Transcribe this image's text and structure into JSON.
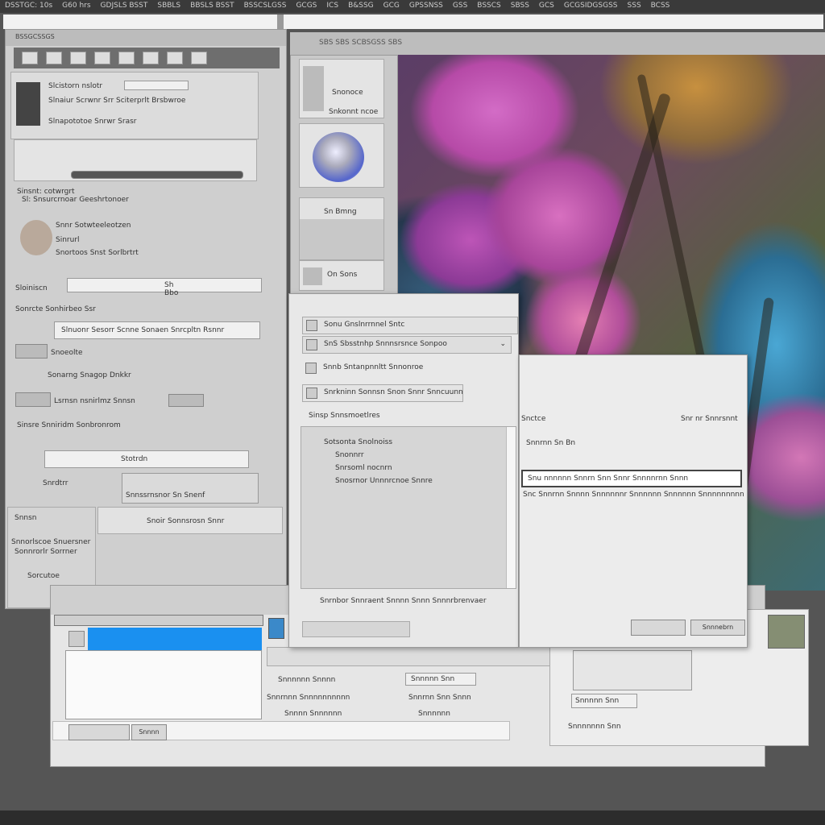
{
  "menubar": {
    "items": [
      "DSSTGC: 10s",
      "G60 hrs",
      "GDJSLS BSST",
      "SBBLS",
      "BBSLS BSST",
      "BSSCSLGSS",
      "GCGS",
      "ICS",
      "B&SSG",
      "GCG",
      "GPSSNSS",
      "GSS",
      "BSSCS",
      "SBSS",
      "GCS",
      "GCGSIDGSGSS",
      "SSS",
      "BCSS"
    ]
  },
  "left_panel": {
    "header": "BSSGCSSGS",
    "layer1_name": "Slcistorn nslotr",
    "layer1_value": "Slnaiur Scrwnr Srr Sciterprlt Brsbwroe",
    "layer2_name": "Slnapototoe Snrwr Srasr",
    "section_label": "Sinsnt: cotwrgrt",
    "section_sub": "Sl: Snsurcrnoar Geeshrtonoer",
    "profile_name": "Snnr Sotwteeleotzen",
    "profile_sub": "Sinrurl",
    "profile_sub2": "Snortoos Snst Sorlbrtrt",
    "field_label": "Sloiniscn",
    "field_value": "Sh Bbo",
    "opt_row": "Sonrcte Sonhirbeo Ssr",
    "input_value": "Slnuonr Sesorr Scnne Sonaen Snrcpltn Rsnnr",
    "item1": "Snoeolte",
    "item2": "Sonarng Snagop Dnkkr",
    "item3": "Lsrnsn nsnirlmz Snnsn",
    "section2": "Sinsre Snniridm Sonbronrom",
    "btn_center": "Stotrdn",
    "foot1": "Snrdtrr",
    "foot2": "Snnssrnsnor Sn Snenf",
    "foot3": "Snoir Sonnsrosn Snnr",
    "sub_a": "Snnsn",
    "sub_b": "Snnorlscoe Snuersner",
    "sub_c": "Sonnrorlr Sorrner",
    "sub_d": "Sorcutoe"
  },
  "thumb_panel": {
    "thumb1_label": "Snonoce",
    "thumb1_sub": "Snkonnt ncoe",
    "thumb3_label": "Sn Bmng",
    "thumb4_label": "On Sons"
  },
  "main_header": "SBS SBS SCBSGSS SBS",
  "dialog": {
    "row1": "Sonu Gnslnrrnnel Sntc",
    "row2": "SnS Sbsstnhp Snnnsrsnce Sonpoo",
    "row3": "Snnb Sntanpnnltt Snnonroe",
    "row4": "Snrkninn Sonnsn Snon Snnr Snncuunn",
    "list_header": "Sinsp Snnsmoetlres",
    "list_item1": "Sotsonta Snolnoiss",
    "list_item2": "Snonnrr",
    "list_item3": "Snrsoml nocnrn",
    "list_item4": "Snosrnor Unnnrcnoe Snnre",
    "bottom_row": "Snrnbor Snnraent Snnnn Snnn Snnnrbrenvaer",
    "btn_left": "",
    "btn_ok": "",
    "btn_cancel": "Snnnebrn"
  },
  "dialog2": {
    "label_left": "Snctce",
    "label_right": "Snr nr Snnrsnnt",
    "sub": "Snnrnn Sn Bn",
    "selected_value": "Snu nnnnnn Snnrn Snn Snnr Snnnnrnn Snnn",
    "description": "Snc Snnrnn Snnnn Snnnnnnr Snnnnnn Snnnnnn Snnnnnnnnn"
  },
  "bottom_window": {
    "label_a": "Snnnnnn Snnnn",
    "label_b": "Snnrnnn Snnnnnnnnnn",
    "label_c": "Snnnn Snnnnnn",
    "label_d": "Snnnnn Snn",
    "label_e": "Snnrnn  Snn Snnn",
    "label_f": "Snnnnnn",
    "footer_btn": "Snnnn"
  },
  "right_window": {
    "label1": "Snnnnn Snn",
    "label2": "Snnnnnnn Snn"
  },
  "colors": {
    "accent_blue": "#1a90f0",
    "swatch": "#858e73"
  }
}
